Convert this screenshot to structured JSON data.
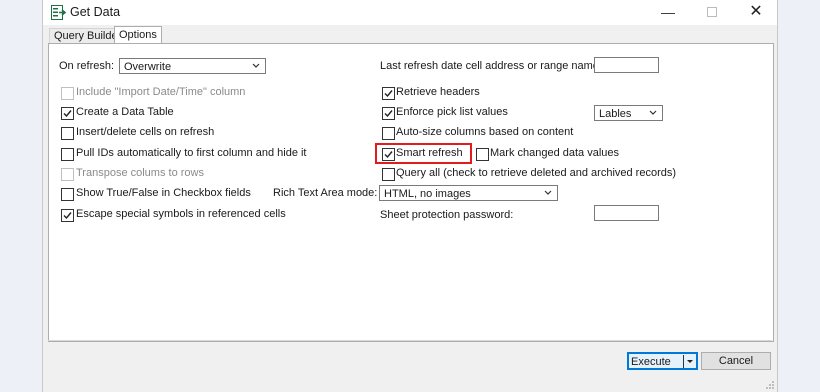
{
  "window": {
    "title": "Get Data",
    "app_icon": "excel-get-data-icon"
  },
  "tabs": [
    {
      "label": "Query Builder",
      "active": false
    },
    {
      "label": "Options",
      "active": true
    }
  ],
  "options": {
    "on_refresh": {
      "label": "On refresh:",
      "value": "Overwrite"
    },
    "last_refresh": {
      "label": "Last refresh date cell address or range name:",
      "value": ""
    },
    "include_import_datetime": {
      "label": "Include \"Import Date/Time\" column",
      "checked": false,
      "disabled": true
    },
    "create_data_table": {
      "label": "Create a Data Table",
      "checked": true
    },
    "insert_delete_cells": {
      "label": "Insert/delete cells on refresh",
      "checked": false
    },
    "pull_ids": {
      "label": "Pull IDs automatically to first column and hide it",
      "checked": false
    },
    "transpose": {
      "label": "Transpose colums to rows",
      "checked": false,
      "disabled": true
    },
    "show_true_false": {
      "label": "Show True/False in Checkbox fields",
      "checked": false
    },
    "escape_symbols": {
      "label": "Escape special symbols in referenced cells",
      "checked": true
    },
    "retrieve_headers": {
      "label": "Retrieve headers",
      "checked": true
    },
    "enforce_picklist": {
      "label": "Enforce pick list values",
      "checked": true
    },
    "picklist_mode": {
      "value": "Lables"
    },
    "autosize_columns": {
      "label": "Auto-size columns based on content",
      "checked": false
    },
    "smart_refresh": {
      "label": "Smart refresh",
      "checked": true,
      "highlighted": true
    },
    "mark_changed": {
      "label": "Mark changed data values",
      "checked": false
    },
    "query_all": {
      "label": "Query all (check to retrieve deleted and archived records)",
      "checked": false
    },
    "rich_text_mode": {
      "label": "Rich Text Area mode:",
      "value": "HTML, no images"
    },
    "sheet_password": {
      "label": "Sheet protection password:",
      "value": ""
    }
  },
  "footer": {
    "execute_label": "Execute",
    "cancel_label": "Cancel"
  },
  "colors": {
    "highlight": "#e21b1b",
    "primary_border": "#0078d7",
    "check_green": "#1e7145"
  }
}
